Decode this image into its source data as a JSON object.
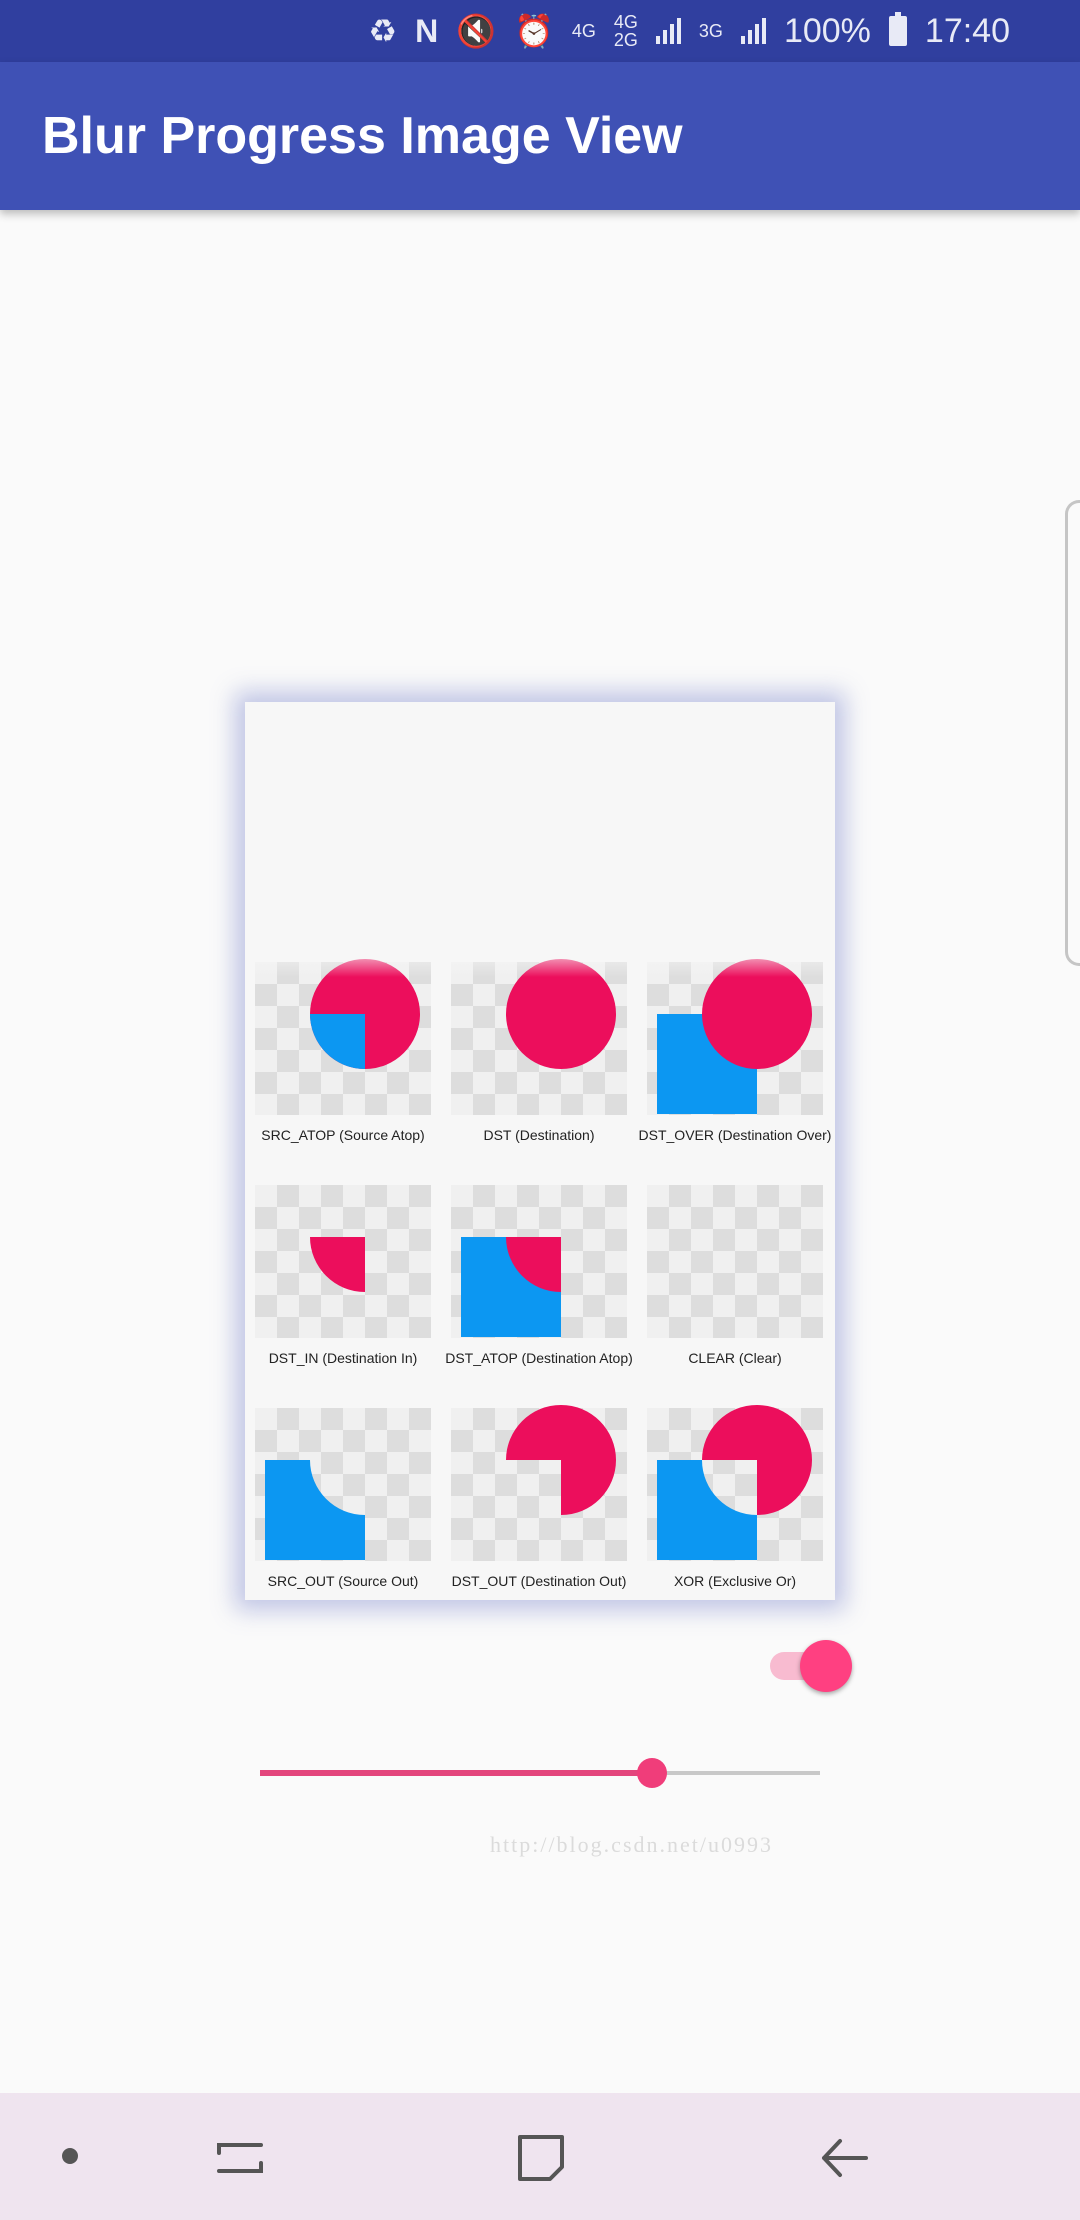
{
  "status_bar": {
    "battery_percent": "100%",
    "time": "17:40",
    "network_labels": [
      "4G",
      "4G",
      "2G",
      "3G"
    ],
    "icons": [
      "sync-icon",
      "nfc-icon",
      "mute-icon",
      "alarm-icon",
      "signal-icon",
      "battery-icon"
    ]
  },
  "app_bar": {
    "title": "Blur Progress Image View"
  },
  "image": {
    "watermark": "http://blog.csdn.net/u0993",
    "cells": [
      {
        "label": "SRC_ATOP (Source Atop)"
      },
      {
        "label": "DST (Destination)"
      },
      {
        "label": "DST_OVER (Destination Over)"
      },
      {
        "label": "DST_IN (Destination In)"
      },
      {
        "label": "DST_ATOP (Destination Atop)"
      },
      {
        "label": "CLEAR (Clear)"
      },
      {
        "label": "SRC_OUT (Source Out)"
      },
      {
        "label": "DST_OUT (Destination Out)"
      },
      {
        "label": "XOR (Exclusive Or)"
      }
    ],
    "colors": {
      "pink": "#ec0e5c",
      "blue": "#0c97f2"
    }
  },
  "controls": {
    "blur_switch_on": true,
    "progress_fraction": 0.7,
    "accent_color": "#ff4081"
  },
  "nav_bar": {
    "buttons": [
      "dot-icon",
      "recent-apps-icon",
      "home-icon",
      "back-icon"
    ]
  }
}
